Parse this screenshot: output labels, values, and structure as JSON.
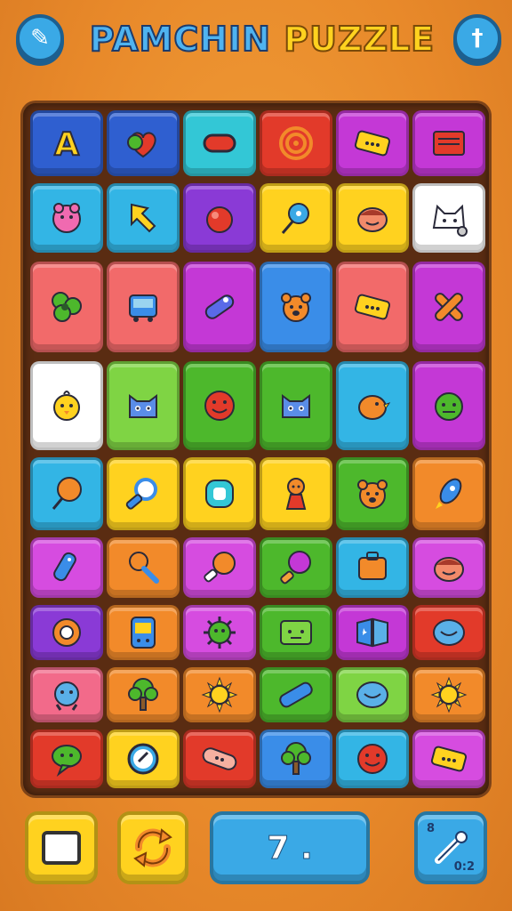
{
  "title": {
    "part1": "PAMCHIN",
    "part2": "PUZZLE"
  },
  "top_left_button": {
    "icon": "pencil-icon",
    "glyph": "✎"
  },
  "top_right_button": {
    "icon": "sword-icon",
    "glyph": "†"
  },
  "board": {
    "rows": [
      [
        {
          "color": "#2f5fd0",
          "icon": "letter-a-icon",
          "text": "A"
        },
        {
          "color": "#2f5fd0",
          "icon": "hearts-icon"
        },
        {
          "color": "#33c7d6",
          "icon": "red-pill-icon"
        },
        {
          "color": "#e23a2a",
          "icon": "target-icon"
        },
        {
          "color": "#c438d6",
          "icon": "ticket-icon"
        },
        {
          "color": "#c438d6",
          "icon": "card-icon"
        }
      ],
      [
        {
          "color": "#33b5e5",
          "icon": "pig-icon"
        },
        {
          "color": "#33b5e5",
          "icon": "arrow-icon"
        },
        {
          "color": "#8a3ad6",
          "icon": "ball-icon"
        },
        {
          "color": "#ffd21f",
          "icon": "lollipop-icon"
        },
        {
          "color": "#ffd21f",
          "icon": "face-icon"
        },
        {
          "color": "#ffffff",
          "icon": "cat-icon"
        }
      ],
      [
        {
          "color": "#f26a6a",
          "icon": "clover-icon"
        },
        {
          "color": "#f26a6a",
          "icon": "robot-icon"
        },
        {
          "color": "#c438d6",
          "icon": "pill-icon"
        },
        {
          "color": "#3a8de8",
          "icon": "bear-icon"
        },
        {
          "color": "#f26a6a",
          "icon": "ticket-icon"
        },
        {
          "color": "#c438d6",
          "icon": "cross-icon"
        }
      ],
      [
        {
          "color": "#ffffff",
          "icon": "chick-icon"
        },
        {
          "color": "#7fd444",
          "icon": "cat-face-icon"
        },
        {
          "color": "#4db82c",
          "icon": "smile-icon"
        },
        {
          "color": "#4db82c",
          "icon": "cat-face-icon"
        },
        {
          "color": "#33b5e5",
          "icon": "bird-icon"
        },
        {
          "color": "#c438d6",
          "icon": "monster-icon"
        }
      ],
      [
        {
          "color": "#33b5e5",
          "icon": "balloon-icon"
        },
        {
          "color": "#ffd21f",
          "icon": "magnifier-icon"
        },
        {
          "color": "#ffd21f",
          "icon": "bubble-icon"
        },
        {
          "color": "#ffd21f",
          "icon": "doll-icon"
        },
        {
          "color": "#4db82c",
          "icon": "bear-icon"
        },
        {
          "color": "#f28a2a",
          "icon": "rocket-icon"
        }
      ],
      [
        {
          "color": "#d64ce0",
          "icon": "tag-icon"
        },
        {
          "color": "#f28a2a",
          "icon": "rattle-icon"
        },
        {
          "color": "#d64ce0",
          "icon": "drumstick-icon"
        },
        {
          "color": "#4db82c",
          "icon": "candy-icon"
        },
        {
          "color": "#33b5e5",
          "icon": "box-icon"
        },
        {
          "color": "#d64ce0",
          "icon": "face-icon"
        }
      ],
      [
        {
          "color": "#8a3ad6",
          "icon": "flower-icon"
        },
        {
          "color": "#f28a2a",
          "icon": "phone-icon"
        },
        {
          "color": "#d64ce0",
          "icon": "germ-icon"
        },
        {
          "color": "#4db82c",
          "icon": "box-face-icon"
        },
        {
          "color": "#c438d6",
          "icon": "book-icon"
        },
        {
          "color": "#e23a2a",
          "icon": "blob-icon"
        }
      ],
      [
        {
          "color": "#f26a8a",
          "icon": "creature-icon"
        },
        {
          "color": "#f28a2a",
          "icon": "tree-icon"
        },
        {
          "color": "#f28a2a",
          "icon": "sun-icon"
        },
        {
          "color": "#4db82c",
          "icon": "tube-icon"
        },
        {
          "color": "#7fd444",
          "icon": "blob-icon"
        },
        {
          "color": "#f28a2a",
          "icon": "sun-icon"
        }
      ],
      [
        {
          "color": "#e23a2a",
          "icon": "chat-icon"
        },
        {
          "color": "#ffd21f",
          "icon": "clock-icon"
        },
        {
          "color": "#e23a2a",
          "icon": "bandage-icon"
        },
        {
          "color": "#3a8de8",
          "icon": "tree-icon"
        },
        {
          "color": "#33b5e5",
          "icon": "smile-icon"
        },
        {
          "color": "#d64ce0",
          "icon": "ticket-icon"
        }
      ]
    ]
  },
  "bottom_bar": {
    "left_button": {
      "icon": "square-icon",
      "color": "#ffd21f"
    },
    "shuffle_button": {
      "icon": "shuffle-icon",
      "color": "#ffd21f"
    },
    "score_display": {
      "text": "7 .",
      "color": "#3aa9e6"
    },
    "hint_button": {
      "icon": "pin-icon",
      "color": "#3aa9e6",
      "top_label": "8",
      "bottom_label": "0:2"
    }
  }
}
